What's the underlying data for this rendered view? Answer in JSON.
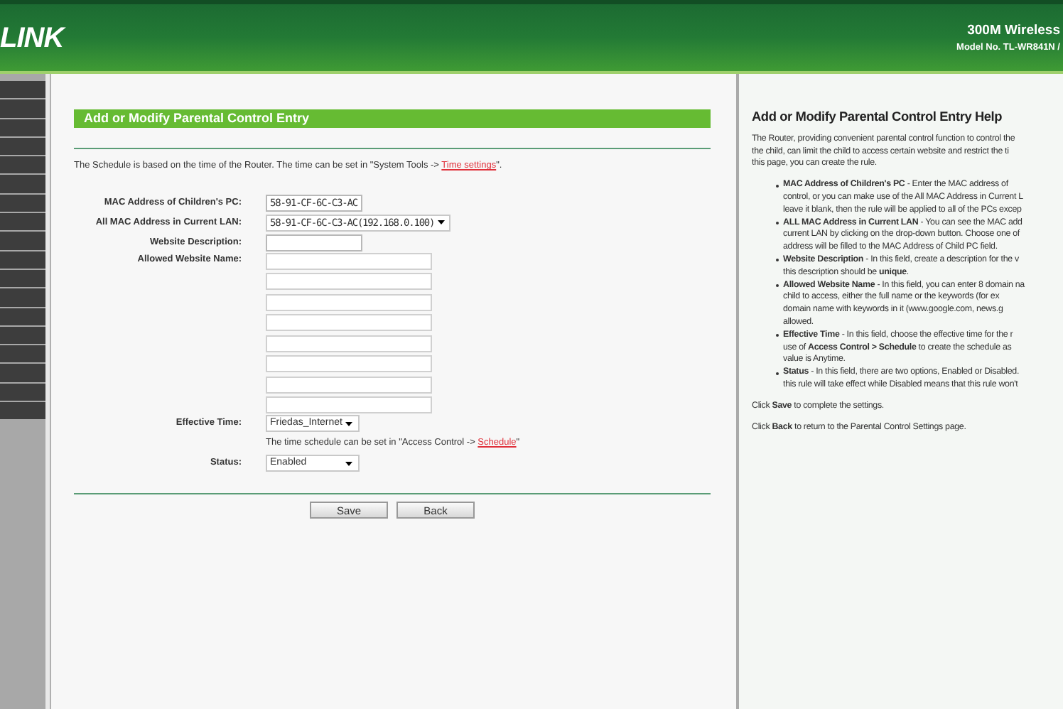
{
  "header": {
    "logo": "LINK",
    "product": "300M Wireless",
    "model": "Model No. TL-WR841N /"
  },
  "form": {
    "title": "Add or Modify Parental Control Entry",
    "note": "The Schedule is based on the time of the Router. The time can be set in \"System Tools -> ",
    "note_link": "Time settings",
    "note_end": "\".",
    "fields": [
      {
        "label": "MAC Address of Children's PC:",
        "kind": "input",
        "value": "58-91-CF-6C-C3-AC"
      },
      {
        "label": "All MAC Address in Current LAN:",
        "kind": "select",
        "value": "58-91-CF-6C-C3-AC(192.168.0.100)"
      },
      {
        "label": "Website Description:",
        "kind": "input"
      },
      {
        "label": "Allowed Website Name:",
        "kind": "inputs"
      },
      {
        "label": "Effective Time:",
        "kind": "select",
        "value": "Friedas_Internet"
      },
      {
        "kind": "note",
        "text": "The time schedule can be set in \"Access Control -> ",
        "link": "Schedule",
        "end": "\""
      },
      {
        "label": "Status:",
        "kind": "select",
        "value": "Enabled"
      }
    ],
    "buttons": [
      "Save",
      "Back"
    ]
  },
  "help": {
    "title": "Add or Modify Parental Control Entry Help",
    "intro": [
      "The Router, providing convenient parental control function to control the",
      "the child, can limit the child to access certain website and restrict the ti",
      "this page, you can create the rule."
    ],
    "bullets": [
      [
        "**MAC Address of Children's PC** - Enter the MAC address of",
        "control, or you can make use of the All MAC Address in Current L",
        "leave it blank, then the rule will be applied to all of the PCs excep"
      ],
      [
        "**ALL MAC Address in Current LAN** - You can see the MAC add",
        "current LAN by clicking on the drop-down button. Choose one of",
        "address will be filled to the MAC Address of Child PC field."
      ],
      [
        "**Website Description** - In this field, create a description for the v",
        "this description should be **unique**."
      ],
      [
        "**Allowed Website Name** - In this field, you can enter 8 domain na",
        "child to access, either the full name or the keywords (for ex",
        "domain name with keywords in it (www.google.com, news.g",
        "allowed."
      ],
      [
        "**Effective Time** - In this field, choose the effective time for the r",
        "use of **Access Control > Schedule** to create the schedule as",
        "value is Anytime."
      ],
      [
        "**Status** - In this field, there are two options, Enabled or Disabled.",
        "this rule will take effect while Disabled means that this rule won't"
      ]
    ],
    "footer": [
      "Click **Save** to complete the settings.",
      "Click **Back** to return to the Parental Control Settings page."
    ]
  }
}
